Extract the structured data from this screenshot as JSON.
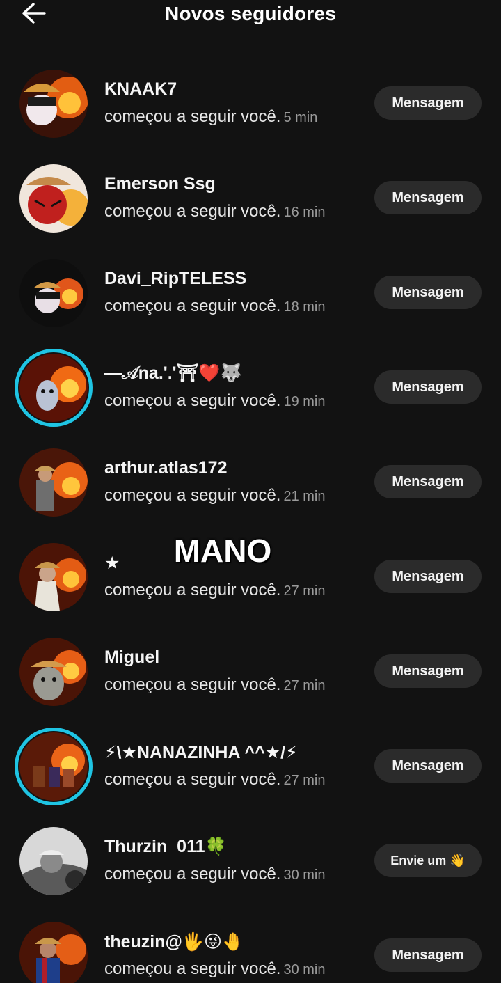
{
  "header": {
    "title": "Novos seguidores",
    "back_icon": "arrow-left-icon"
  },
  "overlay": {
    "text": "MANO"
  },
  "followers": [
    {
      "name": "KNAAK7",
      "action": "começou a seguir você.",
      "time": "5 min",
      "button": "Mensagem",
      "story_ring": false
    },
    {
      "name": "Emerson Ssg",
      "action": "começou a seguir você.",
      "time": "16 min",
      "button": "Mensagem",
      "story_ring": false
    },
    {
      "name": "Davi_RipTELESS",
      "action": "começou a seguir você.",
      "time": "18 min",
      "button": "Mensagem",
      "story_ring": false
    },
    {
      "name": "—𝒜na.'.'⛩❤️🐺",
      "action": "começou a seguir você.",
      "time": "19 min",
      "button": "Mensagem",
      "story_ring": true
    },
    {
      "name": "arthur.atlas172",
      "action": "começou a seguir você.",
      "time": "21 min",
      "button": "Mensagem",
      "story_ring": false
    },
    {
      "name": "★",
      "action": "começou a seguir você.",
      "time": "27 min",
      "button": "Mensagem",
      "story_ring": false
    },
    {
      "name": "Miguel",
      "action": "começou a seguir você.",
      "time": "27 min",
      "button": "Mensagem",
      "story_ring": false
    },
    {
      "name": "⚡\\★NANAZINHA ^^★/⚡",
      "action": "começou a seguir você.",
      "time": "27 min",
      "button": "Mensagem",
      "story_ring": true
    },
    {
      "name": "Thurzin_011🍀",
      "action": "começou a seguir você.",
      "time": "30 min",
      "button": "Envie um 👋",
      "story_ring": false
    },
    {
      "name": "theuzin@🖐😜🤚",
      "action": "começou a seguir você.",
      "time": "30 min",
      "button": "Mensagem",
      "story_ring": false
    }
  ],
  "colors": {
    "background": "#121212",
    "button": "#2b2b2b",
    "story_ring": "#1fc4e3"
  }
}
